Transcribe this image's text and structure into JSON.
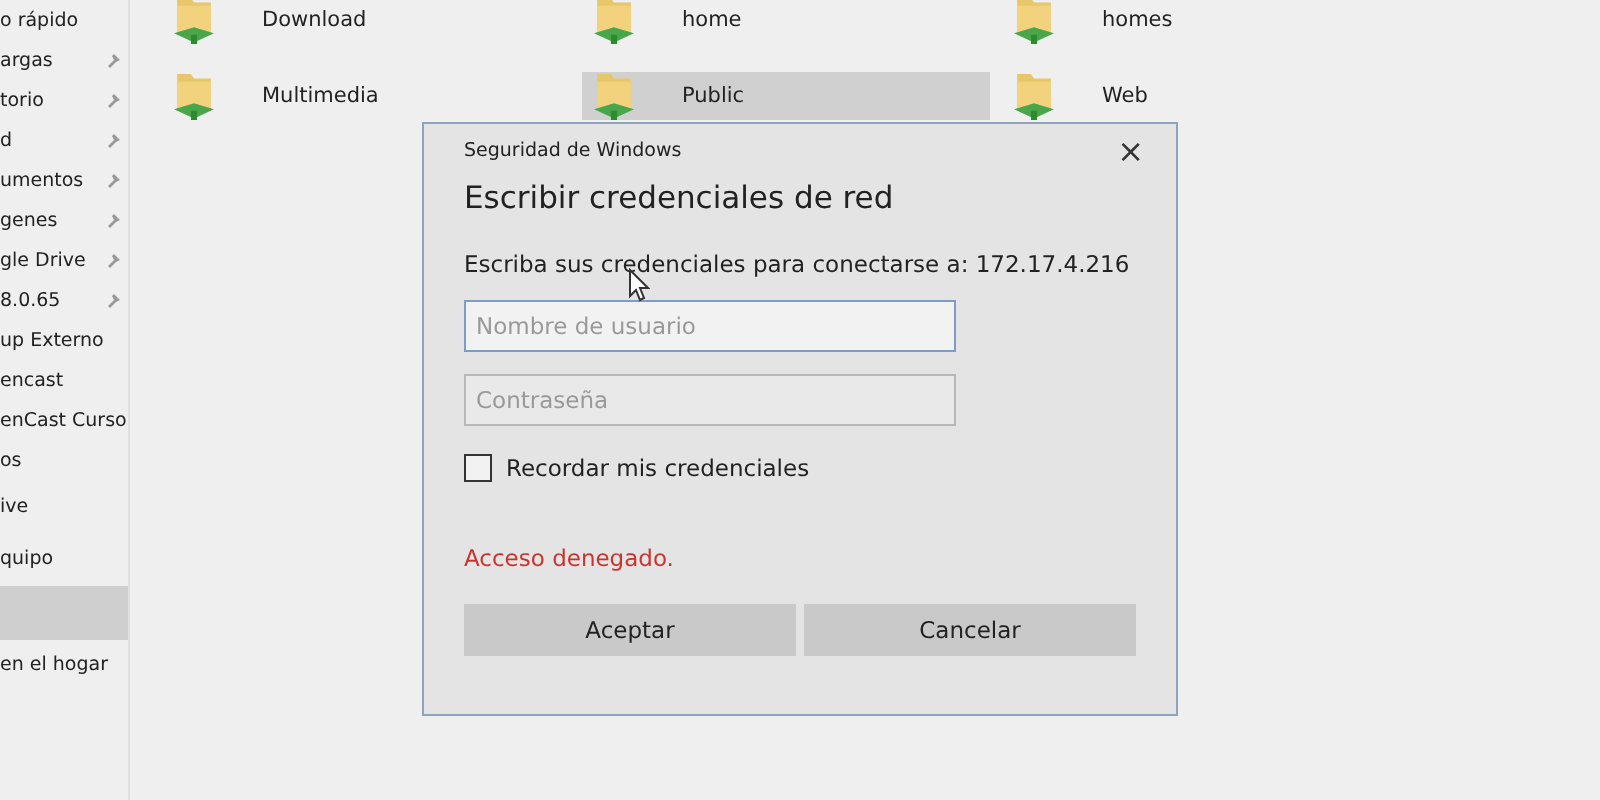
{
  "sidebar": {
    "items": [
      {
        "label": "o rápido",
        "pinned": false,
        "selected": false
      },
      {
        "label": "argas",
        "pinned": true,
        "selected": false
      },
      {
        "label": "torio",
        "pinned": true,
        "selected": false
      },
      {
        "label": "d",
        "pinned": true,
        "selected": false
      },
      {
        "label": "umentos",
        "pinned": true,
        "selected": false
      },
      {
        "label": "genes",
        "pinned": true,
        "selected": false
      },
      {
        "label": "gle Drive",
        "pinned": true,
        "selected": false
      },
      {
        "label": "8.0.65",
        "pinned": true,
        "selected": false
      },
      {
        "label": "up Externo",
        "pinned": false,
        "selected": false
      },
      {
        "label": "encast",
        "pinned": false,
        "selected": false
      },
      {
        "label": "enCast Curso",
        "pinned": false,
        "selected": false
      },
      {
        "label": "os",
        "pinned": false,
        "selected": false
      },
      {
        "label": "ive",
        "pinned": false,
        "selected": false
      },
      {
        "label": "quipo",
        "pinned": false,
        "selected": false
      },
      {
        "selected": true,
        "pinned": false
      },
      {
        "label": "en el hogar",
        "pinned": false,
        "selected": false
      }
    ]
  },
  "folders": [
    {
      "name": "Download",
      "selected": false
    },
    {
      "name": "home",
      "selected": false
    },
    {
      "name": "homes",
      "selected": false
    },
    {
      "name": "Multimedia",
      "selected": false
    },
    {
      "name": "Public",
      "selected": true
    },
    {
      "name": "Web",
      "selected": false
    }
  ],
  "dialog": {
    "caption": "Seguridad de Windows",
    "close": "×",
    "title": "Escribir credenciales de red",
    "prompt": "Escriba sus credenciales para conectarse a: 172.17.4.216",
    "username": {
      "placeholder": "Nombre de usuario",
      "focused": true
    },
    "password": {
      "placeholder": "Contraseña",
      "focused": false
    },
    "remember": {
      "label": "Recordar mis credenciales",
      "checked": false
    },
    "error": "Acceso denegado.",
    "buttons": [
      "Aceptar",
      "Cancelar"
    ]
  }
}
